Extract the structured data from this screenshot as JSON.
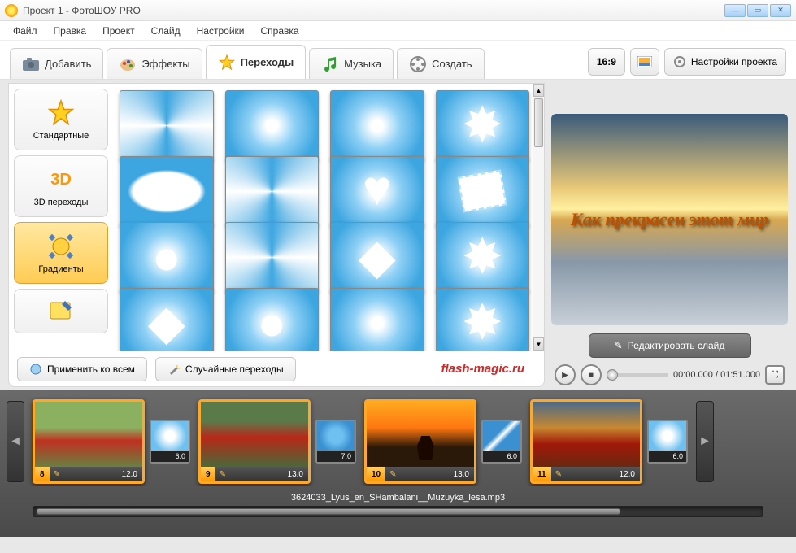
{
  "window": {
    "title": "Проект 1 - ФотоШОУ PRO"
  },
  "menu": [
    "Файл",
    "Правка",
    "Проект",
    "Слайд",
    "Настройки",
    "Справка"
  ],
  "tabs": {
    "add": "Добавить",
    "effects": "Эффекты",
    "transitions": "Переходы",
    "music": "Музыка",
    "create": "Создать"
  },
  "aspect": "16:9",
  "project_settings": "Настройки проекта",
  "categories": {
    "standard": "Стандартные",
    "three_d": "3D переходы",
    "gradients": "Градиенты"
  },
  "footer": {
    "apply_all": "Применить ко всем",
    "random": "Случайные переходы",
    "watermark": "flash-magic.ru"
  },
  "preview": {
    "text": "Как  прекрасен этот мир",
    "edit_slide": "Редактировать слайд",
    "time_current": "00:00.000",
    "time_total": "01:51.000"
  },
  "timeline": {
    "slides": [
      {
        "num": "8",
        "dur": "12.0",
        "trans_dur": "6.0"
      },
      {
        "num": "9",
        "dur": "13.0",
        "trans_dur": "7.0"
      },
      {
        "num": "10",
        "dur": "13.0",
        "trans_dur": "6.0"
      },
      {
        "num": "11",
        "dur": "12.0",
        "trans_dur": "6.0"
      }
    ],
    "audio": "3624033_Lyus_en_SHambalani__Muzuyka_lesa.mp3"
  }
}
